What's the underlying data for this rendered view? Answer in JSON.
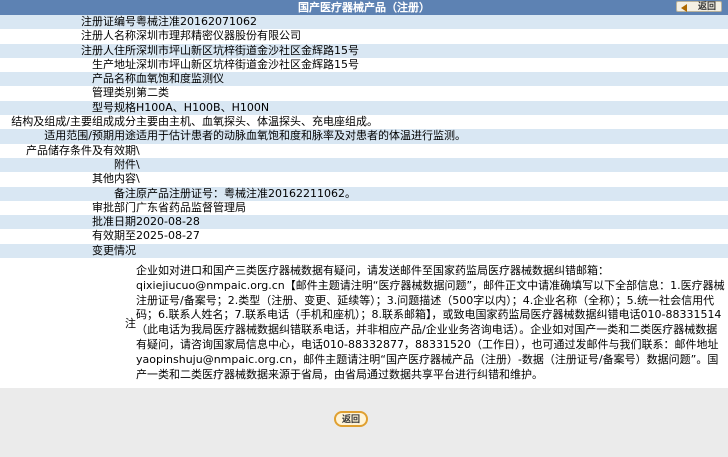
{
  "header": {
    "title": "国产医疗器械产品（注册）",
    "back_label": "返回"
  },
  "fields": {
    "reg_no": {
      "label": "注册证编号",
      "value": "粤械注准20162071062"
    },
    "registrant": {
      "label": "注册人名称",
      "value": "深圳市理邦精密仪器股份有限公司"
    },
    "address": {
      "label": "注册人住所",
      "value": "深圳市坪山新区坑梓街道金沙社区金辉路15号"
    },
    "production": {
      "label": "生产地址",
      "value": "深圳市坪山新区坑梓街道金沙社区金辉路15号"
    },
    "product": {
      "label": "产品名称",
      "value": "血氧饱和度监测仪"
    },
    "category": {
      "label": "管理类别",
      "value": "第二类"
    },
    "model": {
      "label": "型号规格",
      "value": "H100A、H100B、H100N"
    },
    "structure": {
      "label": "结构及组成/主要组成成分",
      "value": "主要由主机、血氧探头、体温探头、充电座组成。"
    },
    "scope": {
      "label": "适用范围/预期用途",
      "value": "适用于估计患者的动脉血氧饱和度和脉率及对患者的体温进行监测。"
    },
    "storage": {
      "label": "产品储存条件及有效期",
      "value": "\\"
    },
    "attachment": {
      "label": "附件",
      "value": "\\"
    },
    "other": {
      "label": "其他内容",
      "value": "\\"
    },
    "remark": {
      "label": "备注",
      "value": "原产品注册证号：粤械注准20162211062。"
    },
    "approver": {
      "label": "审批部门",
      "value": "广东省药品监督管理局"
    },
    "approval_date": {
      "label": "批准日期",
      "value": "2020-08-28"
    },
    "valid_until": {
      "label": "有效期至",
      "value": "2025-08-27"
    },
    "changes": {
      "label": "变更情况",
      "value": ""
    }
  },
  "notice": {
    "label": "注",
    "text": "企业如对进口和国产三类医疗器械数据有疑问，请发送邮件至国家药监局医疗器械数据纠错邮箱：qixiejiucuo@nmpaic.org.cn【邮件主题请注明“医疗器械数据问题”，邮件正文中请准确填写以下全部信息：1.医疗器械注册证号/备案号；2.类型（注册、变更、延续等）；3.问题描述（500字以内）；4.企业名称（全称）；5.统一社会信用代码；6.联系人姓名；7.联系电话（手机和座机）；8.联系邮箱】，或致电国家药监局医疗器械数据纠错电话010-88331514（此电话为我局医疗器械数据纠错联系电话，并非相应产品/企业业务咨询电话）。企业如对国产一类和二类医疗器械数据有疑问，请咨询国家局信息中心，电话010-88332877，88331520（工作日），也可通过发邮件与我们联系：邮件地址yaopinshuju@nmpaic.org.cn，邮件主题请注明“国产医疗器械产品（注册）-数据（注册证号/备案号）数据问题”。国产一类和二类医疗器械数据来源于省局，由省局通过数据共享平台进行纠错和维护。"
  },
  "footer": {
    "back_label": "返回"
  },
  "colors": {
    "header_bg": "#5d82b3",
    "row_blue": "#d9e7f3",
    "row_white": "#ffffff",
    "page_bg": "#ebebeb"
  }
}
